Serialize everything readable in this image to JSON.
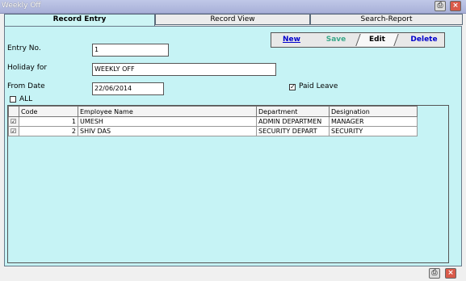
{
  "window": {
    "title": "Weekly Off"
  },
  "tabs": [
    {
      "label": "Record Entry"
    },
    {
      "label": "Record View"
    },
    {
      "label": "Search-Report"
    }
  ],
  "toolbar": {
    "new": "New",
    "save": "Save",
    "edit": "Edit",
    "delete": "Delete"
  },
  "form": {
    "entry_no_label": "Entry No.",
    "entry_no_value": "1",
    "holiday_for_label": "Holiday for",
    "holiday_for_value": "WEEKLY OFF",
    "from_date_label": "From Date",
    "from_date_value": "22/06/2014",
    "paid_leave_label": "Paid Leave",
    "paid_leave_checked": true,
    "all_label": "ALL",
    "all_checked": false
  },
  "grid": {
    "columns": [
      "Code",
      "Employee Name",
      "Department",
      "Designation"
    ],
    "rows": [
      {
        "checked": true,
        "code": "1",
        "name": "UMESH",
        "department": "ADMIN DEPARTMEN",
        "designation": "MANAGER"
      },
      {
        "checked": true,
        "code": "2",
        "name": "SHIV DAS",
        "department": "SECURITY DEPART",
        "designation": "SECURITY"
      }
    ]
  },
  "colors": {
    "panel": "#c6f3f5",
    "accent": "#0000cc"
  },
  "icons": {
    "print": "printer-icon",
    "close": "close-icon"
  }
}
